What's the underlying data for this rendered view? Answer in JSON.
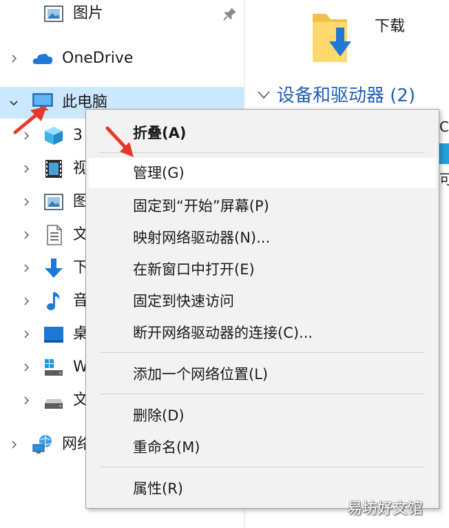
{
  "nav": {
    "items": [
      {
        "label": "图片",
        "icon": "pictures-icon",
        "chevron": "none"
      },
      {
        "label": "OneDrive",
        "icon": "onedrive-cloud-icon",
        "chevron": "right"
      },
      {
        "label": "此电脑",
        "icon": "this-pc-icon",
        "chevron": "down"
      },
      {
        "label": "3",
        "icon": "3d-objects-icon",
        "chevron": "right"
      },
      {
        "label": "视",
        "icon": "videos-icon",
        "chevron": "right"
      },
      {
        "label": "图",
        "icon": "pictures-icon",
        "chevron": "right"
      },
      {
        "label": "文",
        "icon": "documents-icon",
        "chevron": "right"
      },
      {
        "label": "下",
        "icon": "downloads-arrow-icon",
        "chevron": "right"
      },
      {
        "label": "音",
        "icon": "music-note-icon",
        "chevron": "right"
      },
      {
        "label": "桌",
        "icon": "desktop-icon",
        "chevron": "right"
      },
      {
        "label": "W",
        "icon": "windows-drive-icon",
        "chevron": "right"
      },
      {
        "label": "文",
        "icon": "drive-icon",
        "chevron": "right"
      },
      {
        "label": "网络",
        "icon": "network-icon",
        "chevron": "right"
      }
    ]
  },
  "content": {
    "downloads_label": "下载",
    "section_title": "设备和驱动器 (2)",
    "drive_fragment": "C:",
    "drive_fragment2": "可"
  },
  "context_menu": {
    "items": [
      {
        "label": "折叠(A)",
        "bold": true
      },
      {
        "label": "管理(G)",
        "hover": true
      },
      {
        "label": "固定到“开始”屏幕(P)"
      },
      {
        "label": "映射网络驱动器(N)..."
      },
      {
        "label": "在新窗口中打开(E)"
      },
      {
        "label": "固定到快速访问"
      },
      {
        "label": "断开网络驱动器的连接(C)..."
      },
      {
        "label": "添加一个网络位置(L)"
      },
      {
        "label": "删除(D)"
      },
      {
        "label": "重命名(M)"
      },
      {
        "label": "属性(R)"
      }
    ]
  },
  "watermark": "易坊好文馆",
  "colors": {
    "selection": "#cce8ff",
    "accent_blue": "#1f5fb0",
    "annotation_red": "#e8382a",
    "menu_bg": "#f2f2f2"
  }
}
